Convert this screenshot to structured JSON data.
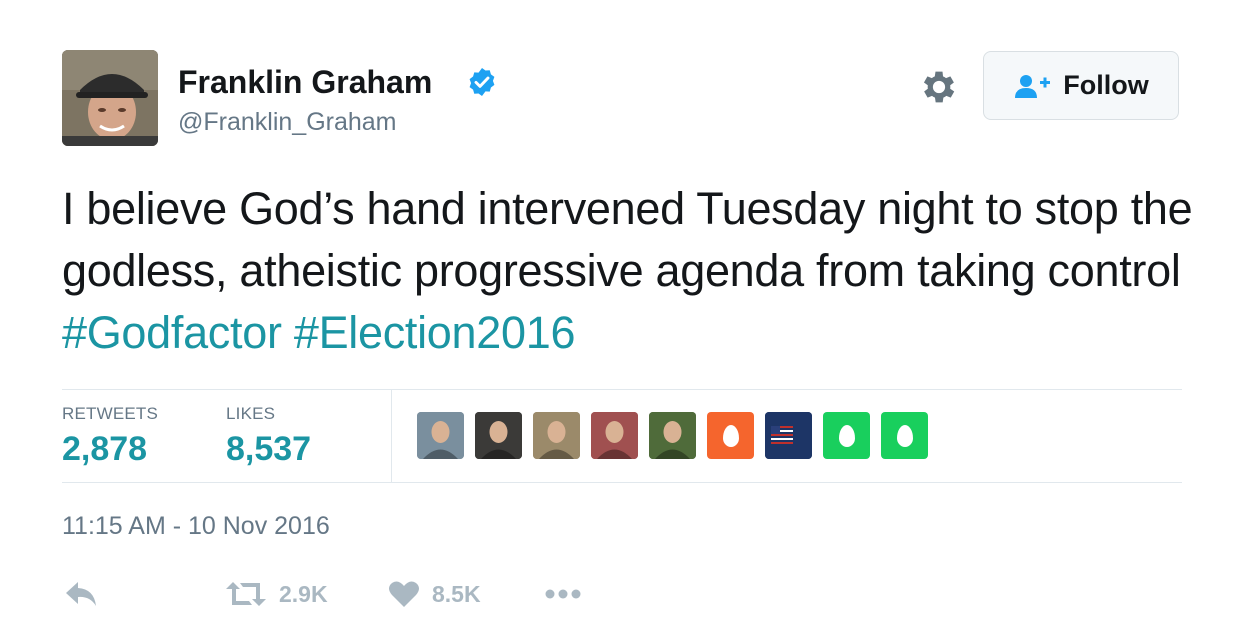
{
  "author": {
    "name": "Franklin Graham",
    "handle": "@Franklin_Graham",
    "verified": true
  },
  "header": {
    "follow_label": "Follow"
  },
  "tweet": {
    "text_plain": "I believe God’s hand intervened Tuesday night to stop the godless, atheistic progressive agenda from taking control ",
    "hashtags": [
      "#Godfactor",
      "#Election2016"
    ]
  },
  "stats": {
    "retweets_label": "RETWEETS",
    "retweets_value": "2,878",
    "likes_label": "LIKES",
    "likes_value": "8,537"
  },
  "likers": [
    {
      "kind": "photo",
      "color": "#7a8f9e"
    },
    {
      "kind": "photo",
      "color": "#3b3a38"
    },
    {
      "kind": "photo",
      "color": "#9b8a6a"
    },
    {
      "kind": "photo",
      "color": "#a05050"
    },
    {
      "kind": "photo",
      "color": "#4f6b3a"
    },
    {
      "kind": "egg",
      "color": "#f5652d"
    },
    {
      "kind": "flag",
      "color": "#1d3566"
    },
    {
      "kind": "egg",
      "color": "#19cf5d"
    },
    {
      "kind": "egg",
      "color": "#19cf5d"
    }
  ],
  "timestamp": "11:15 AM - 10 Nov 2016",
  "actions": {
    "reply_icon": "reply-icon",
    "retweet_count": "2.9K",
    "like_count": "8.5K",
    "more_icon": "more-icon"
  },
  "colors": {
    "link": "#1b95a3",
    "verified": "#1da1f2",
    "muted": "#657786",
    "action": "#aab8c2"
  }
}
